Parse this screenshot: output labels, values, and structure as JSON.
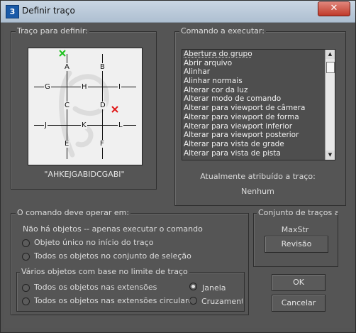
{
  "window": {
    "title": "Definir traço",
    "icon_letter": "3",
    "close_label": "✕"
  },
  "stroke_panel": {
    "legend": "Traço para definir:",
    "grid_labels": {
      "A": "A",
      "B": "B",
      "C": "C",
      "D": "D",
      "E": "E",
      "F": "F",
      "G": "G",
      "H": "H",
      "I": "I",
      "J": "J",
      "K": "K",
      "L": "L"
    },
    "stroke_code": "\"AHKEJGABIDCGABI\""
  },
  "command_panel": {
    "legend": "Comando a executar:",
    "items": [
      "Abertura do grupo",
      "Abrir arquivo",
      "Alinhar",
      "Alinhar normais",
      "Alterar cor da luz",
      "Alterar modo de comando",
      "Alterar para viewport de câmera",
      "Alterar para viewport de forma",
      "Alterar para viewport inferior",
      "Alterar para viewport posterior",
      "Alterar para vista de grade",
      "Alterar para vista de pista"
    ],
    "assigned_label": "Atualmente atribuído a traço:",
    "assigned_value": "Nenhum"
  },
  "operate_panel": {
    "legend": "O comando deve operar em:",
    "no_objects": "Não há objetos -- apenas executar o comando",
    "single_object": "Objeto único no início do traço",
    "all_in_selection": "Todos os objetos no conjunto de seleção",
    "multi": {
      "legend": "Vários objetos com base no limite de traço",
      "all_in_extents": "Todos os objetos nas extensões",
      "all_in_circular": "Todos os objetos nas extensões circulares",
      "window": "Janela",
      "crossing": "Cruzamento"
    }
  },
  "stroke_set_panel": {
    "legend": "Conjunto de traços atu",
    "set_name": "MaxStr",
    "review_button": "Revisão"
  },
  "buttons": {
    "ok": "OK",
    "cancel": "Cancelar"
  }
}
